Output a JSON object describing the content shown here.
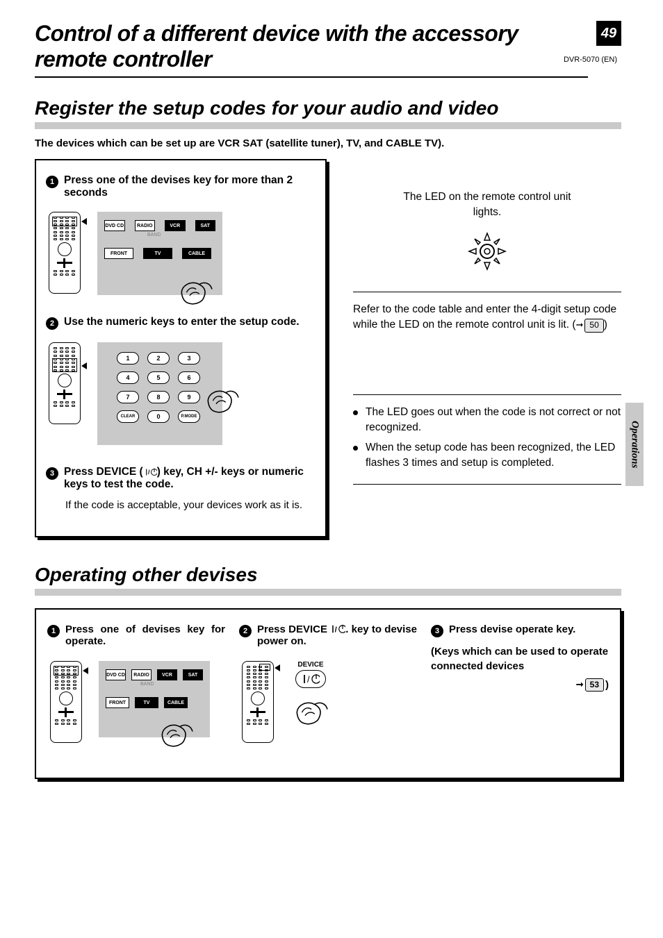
{
  "page_number": "49",
  "doc_id": "DVR-5070 (EN)",
  "title": "Control of a different device with the accessory remote controller",
  "section1": {
    "heading": "Register the setup codes for your audio and video",
    "intro": "The devices which can be set up are VCR SAT (satellite tuner), TV, and CABLE TV).",
    "step1": {
      "num": "1",
      "title": "Press one of the devises key for more than 2 seconds",
      "keys_row1": [
        "DVD CD",
        "RADIO",
        "VCR",
        "SAT"
      ],
      "band_label": "BAND",
      "keys_row2": [
        "FRONT",
        "TV",
        "CABLE"
      ],
      "right_text": "The LED on the remote control unit lights."
    },
    "step2": {
      "num": "2",
      "title": "Use the numeric keys to enter the setup code.",
      "numkeys_r1": [
        "1",
        "2",
        "3"
      ],
      "numkeys_r2": [
        "4",
        "5",
        "6"
      ],
      "numkeys_r3": [
        "7",
        "8",
        "9"
      ],
      "numkeys_r4": [
        "CLEAR",
        "0",
        "P.MODE"
      ],
      "right_text_a": "Refer to the code table and enter the 4-digit setup code while the LED on the remote control unit is lit. (",
      "page_ref": "50",
      "right_text_b": ")",
      "bullet1": "The LED goes out when the code is not correct or not recognized.",
      "bullet2": "When the setup code has been recognized, the LED flashes 3 times and setup is completed."
    },
    "step3": {
      "num": "3",
      "title": "Press DEVICE (   ) key, CH +/- keys or numeric keys to test the code.",
      "body": "If the code is acceptable, your devices work as it is."
    }
  },
  "side_tab": "Operations",
  "section2": {
    "heading": "Operating other devises",
    "col1": {
      "num": "1",
      "title": "Press one of devises key for operate.",
      "keys_row1": [
        "DVD CD",
        "RADIO",
        "VCR",
        "SAT"
      ],
      "band_label": "BAND",
      "keys_row2": [
        "FRONT",
        "TV",
        "CABLE"
      ]
    },
    "col2": {
      "num": "2",
      "title_a": "Press DEVICE ",
      "title_b": ". key to devise power on.",
      "device_label": "DEVICE"
    },
    "col3": {
      "num": "3",
      "title": "Press devise operate key.",
      "note": "(Keys which can be used to operate connected devices",
      "page_ref": "53",
      "note_close": ")"
    }
  }
}
